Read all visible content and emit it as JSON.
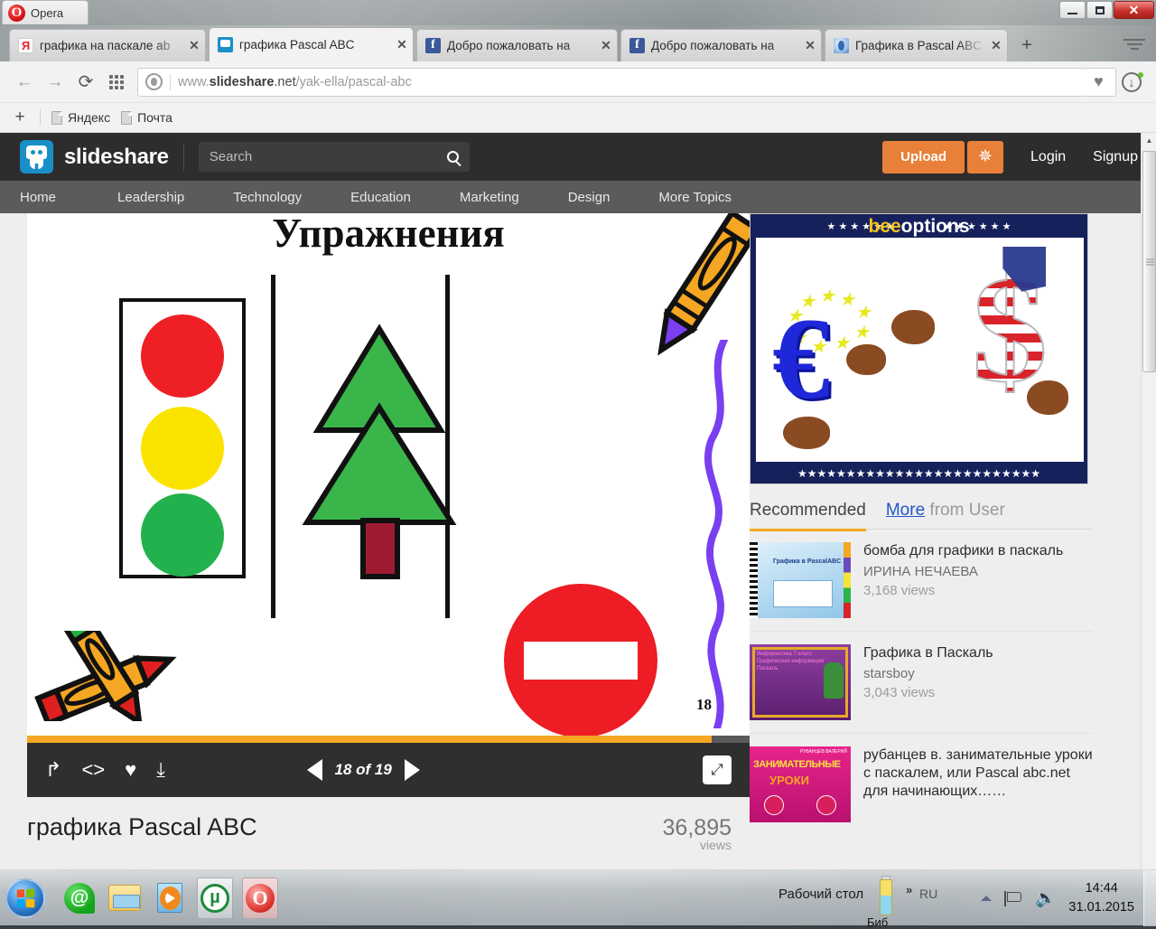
{
  "window": {
    "app_button": "Opera",
    "controls": {
      "minimize": "–",
      "maximize": "□",
      "close": "✕"
    },
    "tabs": [
      {
        "favicon": "yandex-icon",
        "title": "графика на паскале ab",
        "close": "✕",
        "active": false
      },
      {
        "favicon": "slideshare-icon",
        "title": "графика Pascal ABC",
        "close": "✕",
        "active": true
      },
      {
        "favicon": "facebook-icon",
        "title": "Добро пожаловать на",
        "close": "✕",
        "active": false
      },
      {
        "favicon": "facebook-icon",
        "title": "Добро пожаловать на",
        "close": "✕",
        "active": false
      },
      {
        "favicon": "opera-icon",
        "title": "Графика в Pascal ABC -",
        "close": "✕",
        "active": false
      }
    ],
    "new_tab": "+"
  },
  "toolbar": {
    "back": "←",
    "forward": "→",
    "reload": "⟳",
    "speeddial": "grid-icon",
    "url_prefix": "www.",
    "url_domain": "slideshare",
    "url_tld": ".net",
    "url_path": "/yak-ella/pascal-abc",
    "url_full": "www.slideshare.net/yak-ella/pascal-abc",
    "heart": "♥",
    "downloads": "↓"
  },
  "bookmarks": {
    "add": "+",
    "items": [
      {
        "label": "Яндекс"
      },
      {
        "label": "Почта"
      }
    ]
  },
  "slideshare": {
    "brand": "slideshare",
    "search_placeholder": "Search",
    "search_icon": "search-icon",
    "upload_label": "Upload",
    "spark_icon": "sparkle-icon",
    "login_label": "Login",
    "signup_label": "Signup",
    "nav": [
      "Home",
      "Leadership",
      "Technology",
      "Education",
      "Marketing",
      "Design",
      "More Topics"
    ]
  },
  "slide": {
    "title": "Упражнения",
    "page_number": "18",
    "traffic_light": {
      "red": "#ee2025",
      "yellow": "#fbe300",
      "green": "#22b14c"
    },
    "tree_color": "#39b54a",
    "trunk_color": "#9e1b32",
    "sign_color": "#ee1c24",
    "crayon_color": "#f5a623",
    "squiggle_color": "#7a3ff0"
  },
  "player": {
    "share_icon": "share-icon",
    "embed_icon": "embed-code-icon",
    "like_icon": "heart-icon",
    "download_icon": "download-icon",
    "prev_icon": "previous-slide-arrow",
    "next_icon": "next-slide-arrow",
    "counter": "18 of 19",
    "fullscreen_icon": "fullscreen-icon",
    "progress_percent": 94.7
  },
  "deck": {
    "title": "графика Pascal ABC",
    "views_count": "36,895",
    "views_label": "views"
  },
  "ad": {
    "brand_prefix": "bee",
    "brand_suffix": "options",
    "alt": "euro-vs-dollar-boxing-banner"
  },
  "recommended": {
    "tab_primary": "Recommended",
    "tab_secondary_link": "More",
    "tab_secondary_rest": " from User",
    "items": [
      {
        "thumb": "graphics-in-pascalabc-notebook-thumb",
        "thumb_text": "Графика в PascalABC",
        "title": "бомба для графики в паскаль",
        "author": "ИРИНА НЕЧАЕВА",
        "views": "3,168 views"
      },
      {
        "thumb": "graphics-in-pascal-purple-thumb",
        "thumb_text": "",
        "title": "Графика в Паскаль",
        "author": "starsboy",
        "views": "3,043 views"
      },
      {
        "thumb": "entertaining-lessons-thumb",
        "thumb_text": "ЗАНИМАТЕЛЬНЫЕ УРОКИ",
        "title": "рубанцев в. занимательные уроки с паскалем, или Pascal abc.net для начинающих……",
        "author": "",
        "views": ""
      }
    ]
  },
  "taskbar": {
    "start_icon": "windows-start-orb",
    "pinned": [
      {
        "icon": "mail-agent-icon",
        "name": "mail-agent"
      },
      {
        "icon": "folder-explorer-icon",
        "name": "explorer"
      },
      {
        "icon": "media-player-icon",
        "name": "media-player"
      },
      {
        "icon": "utorrent-icon",
        "name": "utorrent"
      },
      {
        "icon": "opera-icon",
        "name": "opera"
      }
    ],
    "desktop_label": "Рабочий стол",
    "library_label": "Биб",
    "overflow_chevron": "»",
    "language": "RU",
    "tray_arrow": "▲",
    "tray_flag_icon": "action-center-flag-icon",
    "tray_volume_icon": "volume-icon",
    "time": "14:44",
    "date": "31.01.2015"
  }
}
